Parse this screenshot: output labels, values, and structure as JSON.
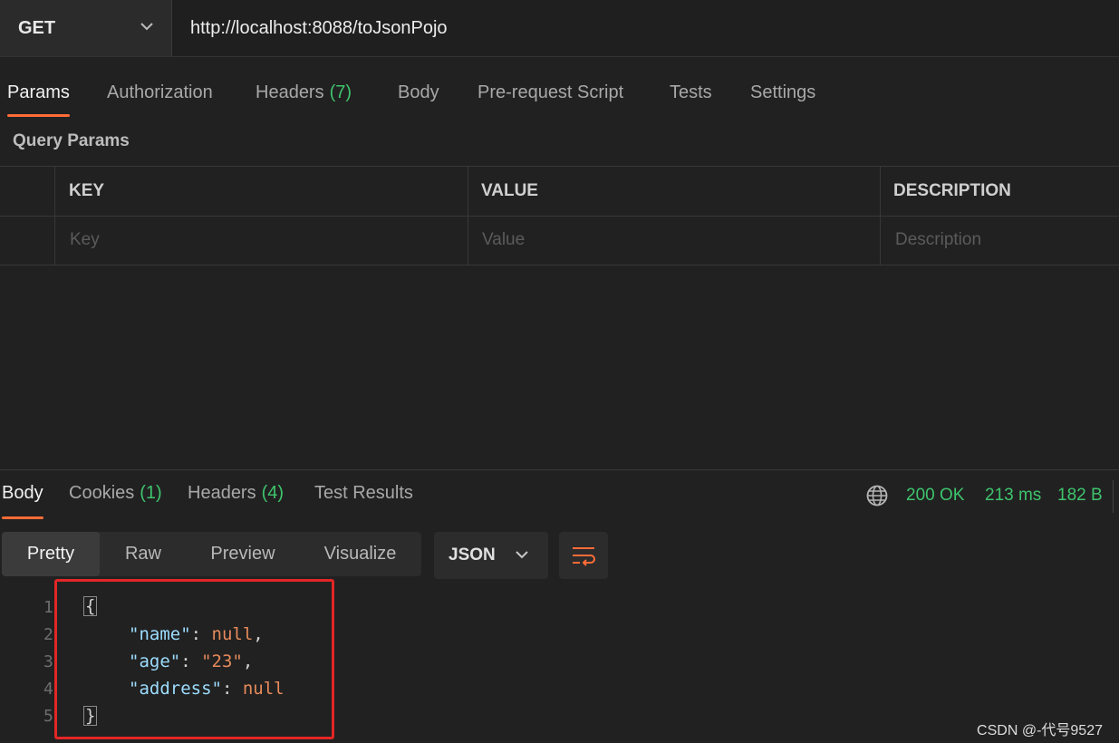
{
  "request": {
    "method": "GET",
    "url": "http://localhost:8088/toJsonPojo"
  },
  "tabs": [
    {
      "label": "Params",
      "count": ""
    },
    {
      "label": "Authorization",
      "count": ""
    },
    {
      "label": "Headers",
      "count": "(7)"
    },
    {
      "label": "Body",
      "count": ""
    },
    {
      "label": "Pre-request Script",
      "count": ""
    },
    {
      "label": "Tests",
      "count": ""
    },
    {
      "label": "Settings",
      "count": ""
    }
  ],
  "query_params": {
    "title": "Query Params",
    "columns": [
      "KEY",
      "VALUE",
      "DESCRIPTION"
    ],
    "placeholders": [
      "Key",
      "Value",
      "Description"
    ]
  },
  "response": {
    "tabs": [
      {
        "label": "Body",
        "count": ""
      },
      {
        "label": "Cookies",
        "count": "(1)"
      },
      {
        "label": "Headers",
        "count": "(4)"
      },
      {
        "label": "Test Results",
        "count": ""
      }
    ],
    "status": "200 OK",
    "time": "213 ms",
    "size": "182 B",
    "view_modes": [
      "Pretty",
      "Raw",
      "Preview",
      "Visualize"
    ],
    "format": "JSON",
    "line_numbers": [
      "1",
      "2",
      "3",
      "4",
      "5"
    ],
    "body": {
      "open": "{",
      "close": "}",
      "lines": [
        {
          "key": "\"name\"",
          "value": "null",
          "sep": ","
        },
        {
          "key": "\"age\"",
          "value": "\"23\"",
          "sep": ","
        },
        {
          "key": "\"address\"",
          "value": "null",
          "sep": ""
        }
      ]
    }
  },
  "watermark": "CSDN @-代号9527",
  "colors": {
    "accent": "#ff6c37",
    "success": "#3ec46d",
    "highlight_box": "#e32626"
  }
}
